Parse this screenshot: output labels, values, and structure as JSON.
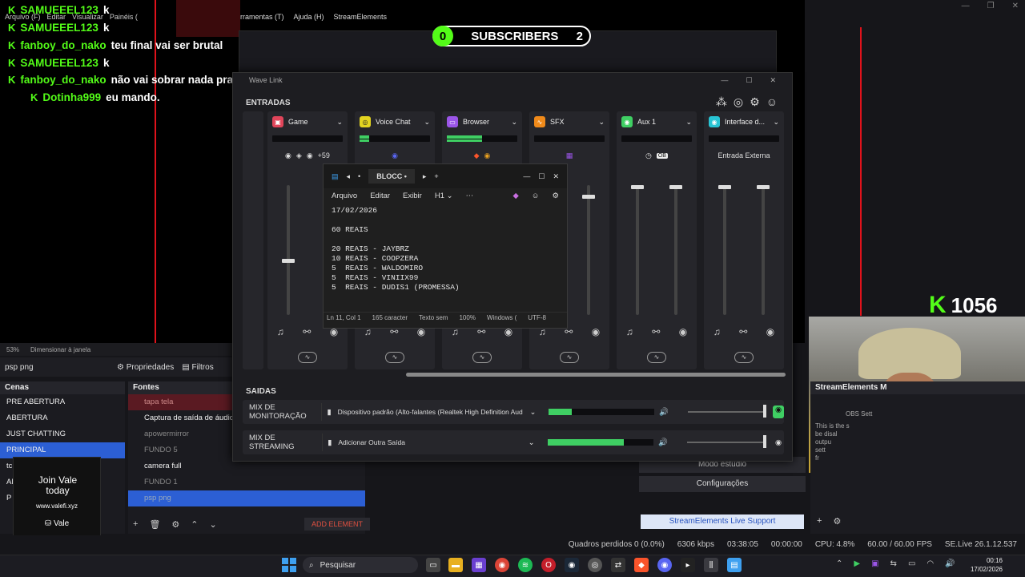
{
  "obs": {
    "menu_left": [
      "Arquivo (F)",
      "Editar",
      "Visualizar",
      "Painéis ("
    ],
    "menu_right": [
      "rramentas (T)",
      "Ajuda (H)",
      "StreamElements"
    ],
    "zoom": "53%",
    "zoom_mode": "Dimensionar à janela",
    "source_name": "psp png",
    "props_label": "Propriedades",
    "filters_label": "Filtros",
    "scenes_title": "Cenas",
    "scenes": [
      "PRE ABERTURA",
      "ABERTURA",
      "JUST CHATTING",
      "PRINCIPAL",
      "tc",
      "Al",
      "P"
    ],
    "sources_title": "Fontes",
    "sources": [
      "tapa tela",
      "Captura de saída de áudio",
      "apowermirror",
      "FUNDO 5",
      "camera full",
      "FUNDO 1",
      "psp png"
    ],
    "add_element": "ADD ELEMENT",
    "studio_mode": "Modo estúdio",
    "settings": "Configurações",
    "se_support": "StreamElements Live Support",
    "se_panel_title": "StreamElements M",
    "se_obs_settings": "OBS Sett",
    "se_text": [
      "This is the s",
      "be disal",
      "outpu",
      "sett",
      "fr"
    ],
    "status": {
      "dropped": "Quadros perdidos 0 (0.0%)",
      "kbps": "6306 kbps",
      "live_time": "03:38:05",
      "rec_time": "00:00:00",
      "cpu": "CPU: 4.8%",
      "fps": "60.00 / 60.00 FPS",
      "version": "SE.Live 26.1.12.537"
    }
  },
  "overlay": {
    "chat": [
      {
        "user": "SAMUEEEL123",
        "msg": "k"
      },
      {
        "user": "SAMUEEEL123",
        "msg": "k"
      },
      {
        "user": "fanboy_do_nako",
        "msg": "teu final vai ser brutal"
      },
      {
        "user": "SAMUEEEL123",
        "msg": "k"
      },
      {
        "user": "fanboy_do_nako",
        "msg": "não vai sobrar nada pra vc"
      },
      {
        "user": "Dotinha999",
        "msg": "eu mando."
      }
    ],
    "subs_left": "0",
    "subs_label": "SUBSCRIBERS",
    "subs_right": "2",
    "kick_icon": "K",
    "kick_count": "1056",
    "join_title": "Join Vale today",
    "join_url": "www.valefi.xyz",
    "join_brand": "Vale"
  },
  "wavelink": {
    "title": "Wave Link",
    "inputs_label": "ENTRADAS",
    "outputs_label": "SAIDAS",
    "channels": [
      {
        "name": "Game",
        "color": "#e0455a",
        "apps": "+59"
      },
      {
        "name": "Voice Chat",
        "color": "#e3d420",
        "apps": ""
      },
      {
        "name": "Browser",
        "color": "#9b55e8",
        "apps": ""
      },
      {
        "name": "SFX",
        "color": "#f08a1a",
        "apps": ""
      },
      {
        "name": "Aux 1",
        "color": "#3fcf63",
        "apps": "OB"
      },
      {
        "name": "Interface d...",
        "color": "#28c4d4",
        "apps": "Entrada Externa"
      }
    ],
    "mixes": [
      {
        "name": "MIX DE MONITORAÇÃO",
        "device": "Dispositivo padrão (Alto-falantes (Realtek High Definition Audio))"
      },
      {
        "name": "MIX DE STREAMING",
        "device": "Adicionar Outra Saída"
      }
    ]
  },
  "notepad": {
    "tab": "BLOCC",
    "menu": [
      "Arquivo",
      "Editar",
      "Exibir"
    ],
    "heading": "H1",
    "lines": [
      "17/02/2026",
      "",
      "60 REAIS",
      "",
      "20 REAIS - JAYBRZ",
      "10 REAIS - COOPZERA",
      "5  REAIS - WALDOMIRO",
      "5  REAIS - VINIIX99",
      "5  REAIS - DUDIS1 (PROMESSA)"
    ],
    "status": [
      "Ln 11, Col 1",
      "165 caracter",
      "Texto sem",
      "100%",
      "Windows (",
      "UTF-8"
    ]
  },
  "taskbar": {
    "search": "Pesquisar",
    "time": "00:16",
    "date": "17/02/2026"
  }
}
